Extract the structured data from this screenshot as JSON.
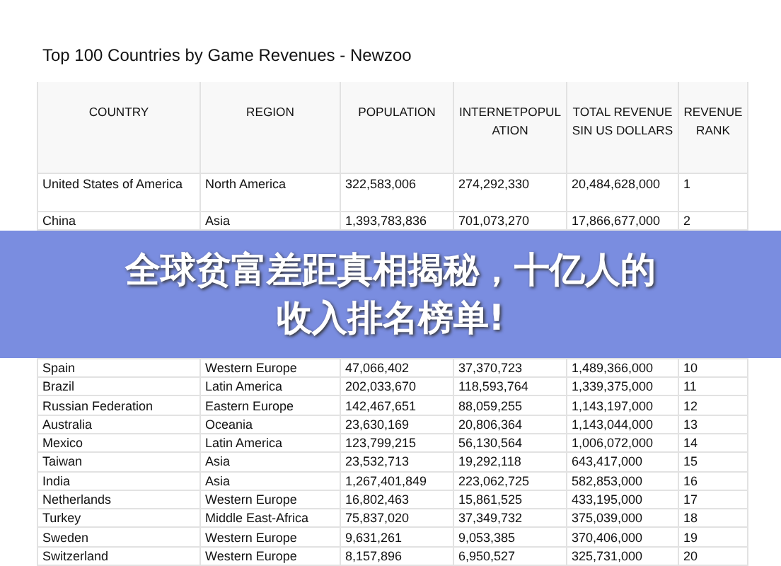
{
  "title": "Top 100 Countries by Game Revenues - Newzoo",
  "table": {
    "columns": [
      "COUNTRY",
      "REGION",
      "POPULATION",
      "INTERNETPOPULATION",
      "TOTAL REVENUESIN US DOLLARS",
      "REVENUERANK"
    ],
    "rows": [
      {
        "country": "United States of America",
        "region": "North America",
        "population": "322,583,006",
        "internet_population": "274,292,330",
        "total_revenues": "20,484,628,000",
        "rank": "1"
      },
      {
        "country": "China",
        "region": "Asia",
        "population": "1,393,783,836",
        "internet_population": "701,073,270",
        "total_revenues": "17,866,677,000",
        "rank": "2"
      },
      {
        "country": "Spain",
        "region": "Western Europe",
        "population": "47,066,402",
        "internet_population": "37,370,723",
        "total_revenues": "1,489,366,000",
        "rank": "10"
      },
      {
        "country": "Brazil",
        "region": "Latin America",
        "population": "202,033,670",
        "internet_population": "118,593,764",
        "total_revenues": "1,339,375,000",
        "rank": "11"
      },
      {
        "country": "Russian Federation",
        "region": "Eastern Europe",
        "population": "142,467,651",
        "internet_population": "88,059,255",
        "total_revenues": "1,143,197,000",
        "rank": "12"
      },
      {
        "country": "Australia",
        "region": "Oceania",
        "population": "23,630,169",
        "internet_population": "20,806,364",
        "total_revenues": "1,143,044,000",
        "rank": "13"
      },
      {
        "country": "Mexico",
        "region": "Latin America",
        "population": "123,799,215",
        "internet_population": "56,130,564",
        "total_revenues": "1,006,072,000",
        "rank": "14"
      },
      {
        "country": "Taiwan",
        "region": "Asia",
        "population": "23,532,713",
        "internet_population": "19,292,118",
        "total_revenues": "643,417,000",
        "rank": "15"
      },
      {
        "country": "India",
        "region": "Asia",
        "population": "1,267,401,849",
        "internet_population": "223,062,725",
        "total_revenues": "582,853,000",
        "rank": "16"
      },
      {
        "country": "Netherlands",
        "region": "Western Europe",
        "population": "16,802,463",
        "internet_population": "15,861,525",
        "total_revenues": "433,195,000",
        "rank": "17"
      },
      {
        "country": "Turkey",
        "region": "Middle East-Africa",
        "population": "75,837,020",
        "internet_population": "37,349,732",
        "total_revenues": "375,039,000",
        "rank": "18"
      },
      {
        "country": "Sweden",
        "region": "Western Europe",
        "population": "9,631,261",
        "internet_population": "9,053,385",
        "total_revenues": "370,406,000",
        "rank": "19"
      },
      {
        "country": "Switzerland",
        "region": "Western Europe",
        "population": "8,157,896",
        "internet_population": "6,950,527",
        "total_revenues": "325,731,000",
        "rank": "20"
      }
    ]
  },
  "banner": {
    "lines": [
      "全球贫富差距真相揭秘，十亿人的",
      "收入排名榜单!"
    ]
  }
}
